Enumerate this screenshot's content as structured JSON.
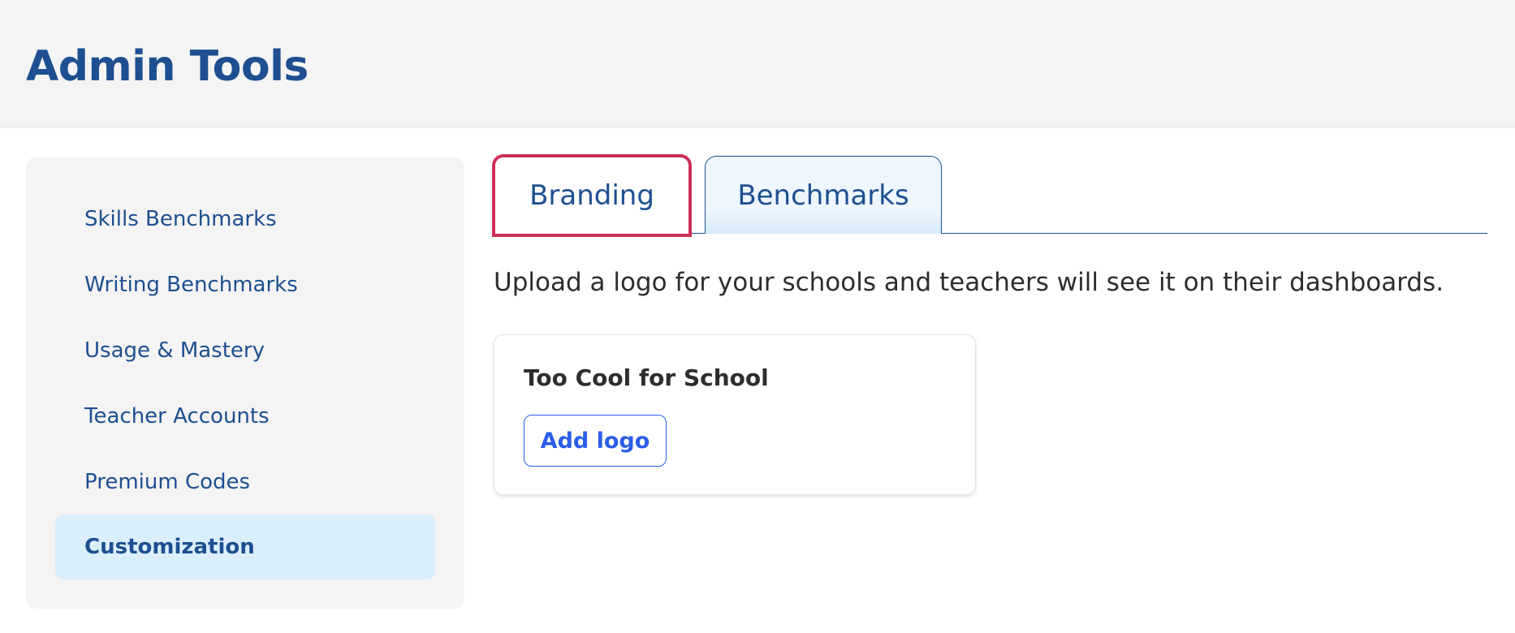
{
  "header": {
    "title": "Admin Tools"
  },
  "sidebar": {
    "items": [
      {
        "label": "Skills Benchmarks"
      },
      {
        "label": "Writing Benchmarks"
      },
      {
        "label": "Usage & Mastery"
      },
      {
        "label": "Teacher Accounts"
      },
      {
        "label": "Premium Codes"
      },
      {
        "label": "Customization",
        "active": true
      }
    ]
  },
  "tabs": [
    {
      "label": "Branding",
      "selected": true
    },
    {
      "label": "Benchmarks",
      "selected": false
    }
  ],
  "main": {
    "description": "Upload a logo for your schools and teachers will see it on their dashboards.",
    "card": {
      "school_name": "Too Cool for School",
      "add_logo_label": "Add logo"
    }
  },
  "colors": {
    "brand_navy": "#1d4f91",
    "header_bg": "#f4f4f4",
    "active_item_bg": "#dbeefc",
    "focus_outline": "#cc2f57",
    "button_blue": "#2a5ee8"
  }
}
